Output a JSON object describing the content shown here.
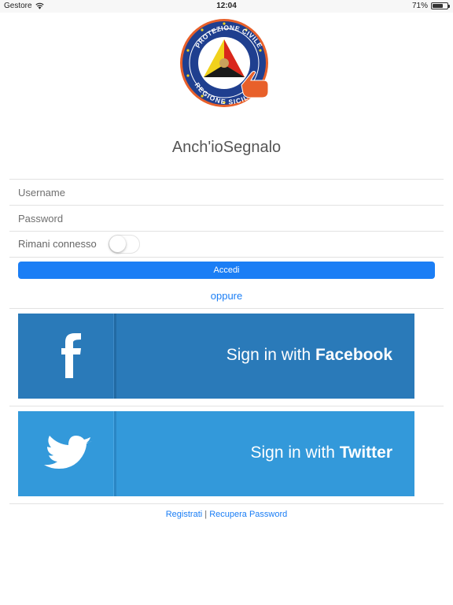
{
  "status_bar": {
    "carrier": "Gestore",
    "time": "12:04",
    "battery": "71%",
    "battery_level": 0.71
  },
  "logo": {
    "text_top": "PROTEZIONE CIVILE",
    "text_bottom": "REGIONE SICILIANA"
  },
  "app_title": "Anch'ioSegnalo",
  "login": {
    "username_placeholder": "Username",
    "password_placeholder": "Password",
    "remember_label": "Rimani connesso",
    "remember_on": false,
    "login_button": "Accedi",
    "or_text": "oppure"
  },
  "social": {
    "facebook": {
      "prefix": "Sign in with ",
      "brand": "Facebook",
      "icon": "facebook-f-icon"
    },
    "twitter": {
      "prefix": "Sign in with ",
      "brand": "Twitter",
      "icon": "twitter-bird-icon"
    }
  },
  "footer": {
    "register": "Registrati",
    "separator": "|",
    "recover": "Recupera Password"
  },
  "colors": {
    "accent": "#1b7ef5",
    "facebook": "#2a7ab9",
    "twitter": "#3399da"
  }
}
